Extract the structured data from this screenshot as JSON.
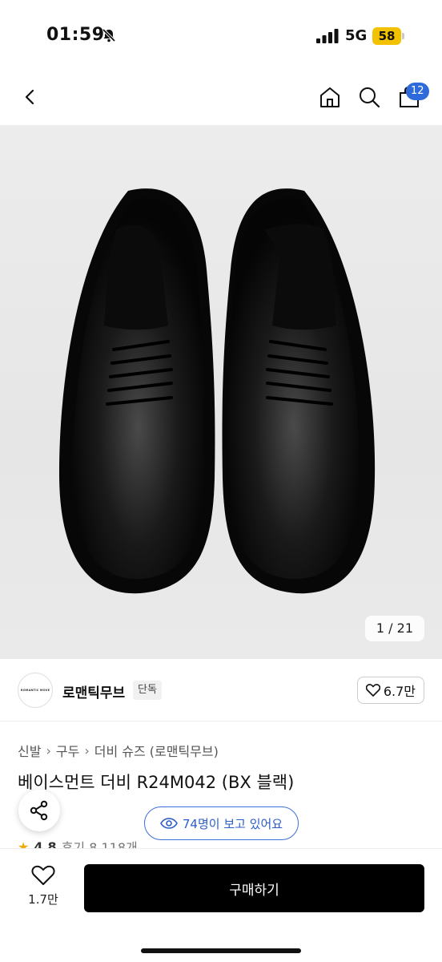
{
  "status_bar": {
    "time": "01:59",
    "network": "5G",
    "battery": "58"
  },
  "nav": {
    "cart_count": "12"
  },
  "product_image": {
    "counter": "1 / 21"
  },
  "brand": {
    "logo_text": "ROMANTIC MOVE",
    "name": "로맨틱무브",
    "tag": "단독",
    "likes": "6.7만"
  },
  "breadcrumb": [
    "신발",
    "구두",
    "더비 슈즈 (로맨틱무브)"
  ],
  "product": {
    "title": "베이스먼트 더비 R24M042 (BX 블랙)",
    "rating": "4.8",
    "reviews": "후기 8,118개"
  },
  "viewers": {
    "label": "74명이 보고 있어요"
  },
  "bottom_bar": {
    "wish_count": "1.7만",
    "buy_label": "구매하기"
  },
  "colors": {
    "accent": "#2e6ad9",
    "battery": "#f2c200",
    "buy_button": "#000000"
  }
}
